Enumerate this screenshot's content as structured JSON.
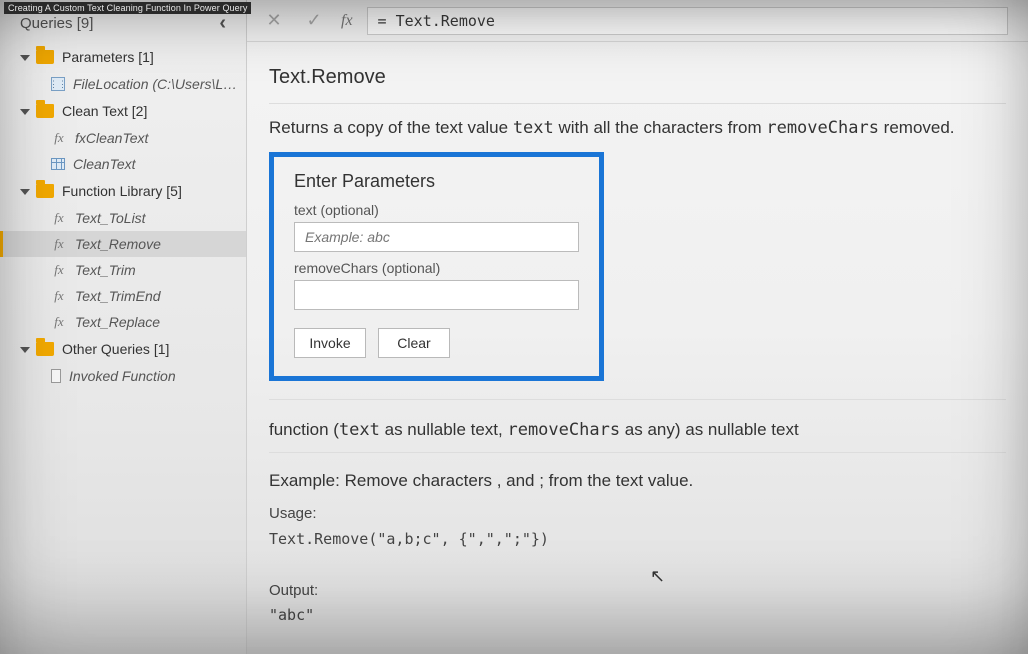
{
  "caption": "Creating A Custom Text Cleaning Function In Power Query",
  "sidebar": {
    "title": "Queries [9]",
    "groups": [
      {
        "label": "Parameters [1]",
        "items": [
          {
            "icon": "param",
            "label": "FileLocation (C:\\Users\\L…"
          }
        ]
      },
      {
        "label": "Clean Text [2]",
        "items": [
          {
            "icon": "fx",
            "label": "fxCleanText"
          },
          {
            "icon": "table",
            "label": "CleanText"
          }
        ]
      },
      {
        "label": "Function Library [5]",
        "items": [
          {
            "icon": "fx",
            "label": "Text_ToList"
          },
          {
            "icon": "fx",
            "label": "Text_Remove",
            "selected": true
          },
          {
            "icon": "fx",
            "label": "Text_Trim"
          },
          {
            "icon": "fx",
            "label": "Text_TrimEnd"
          },
          {
            "icon": "fx",
            "label": "Text_Replace"
          }
        ]
      },
      {
        "label": "Other Queries [1]",
        "items": [
          {
            "icon": "result",
            "label": "Invoked Function"
          }
        ]
      }
    ]
  },
  "formula_bar": {
    "cancel_glyph": "✕",
    "commit_glyph": "✓",
    "fx_label": "fx",
    "formula": "= Text.Remove"
  },
  "doc": {
    "title": "Text.Remove",
    "desc_pre": "Returns a copy of the text value ",
    "desc_mono1": "text",
    "desc_mid": " with all the characters from ",
    "desc_mono2": "removeChars",
    "desc_post": " removed.",
    "param_box_title": "Enter Parameters",
    "params": [
      {
        "label": "text (optional)",
        "placeholder": "Example: abc"
      },
      {
        "label": "removeChars (optional)",
        "placeholder": ""
      }
    ],
    "invoke_label": "Invoke",
    "clear_label": "Clear",
    "sig_pre": "function (",
    "sig_m1": "text",
    "sig_mid1": " as nullable text, ",
    "sig_m2": "removeChars",
    "sig_mid2": " as any) as nullable text",
    "example_title": "Example: Remove characters , and ; from the text value.",
    "usage_label": "Usage:",
    "usage_code": "Text.Remove(\"a,b;c\", {\",\",\";\"})",
    "output_label": "Output:",
    "output_code": "\"abc\""
  }
}
